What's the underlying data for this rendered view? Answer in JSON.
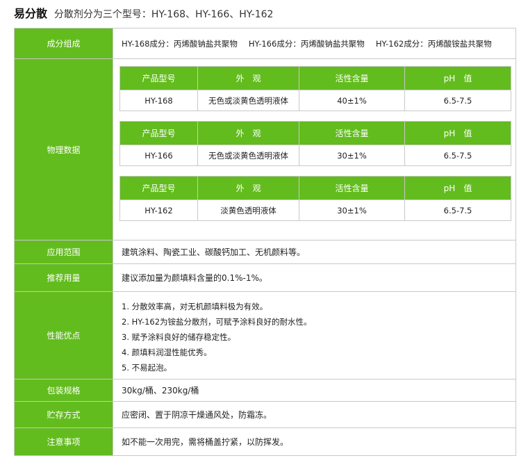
{
  "header": {
    "brand": "易分散",
    "subtitle": "分散剂分为三个型号：HY-168、HY-166、HY-162"
  },
  "rows": {
    "composition": {
      "label": "成分组成",
      "items": [
        "HY-168成分：丙烯酸钠盐共聚物",
        "HY-166成分：丙烯酸钠盐共聚物",
        "HY-162成分：丙烯酸铵盐共聚物"
      ]
    },
    "physical": {
      "label": "物理数据",
      "columns": [
        "产品型号",
        "外　观",
        "活性含量",
        "pH　值"
      ],
      "tables": [
        [
          "HY-168",
          "无色或淡黄色透明液体",
          "40±1%",
          "6.5-7.5"
        ],
        [
          "HY-166",
          "无色或淡黄色透明液体",
          "30±1%",
          "6.5-7.5"
        ],
        [
          "HY-162",
          "淡黄色透明液体",
          "30±1%",
          "6.5-7.5"
        ]
      ]
    },
    "application": {
      "label": "应用范围",
      "text": "建筑涂料、陶瓷工业、碳酸钙加工、无机颜料等。"
    },
    "dosage": {
      "label": "推荐用量",
      "text": "建议添加量为颜填料含量的0.1%-1%。"
    },
    "performance": {
      "label": "性能优点",
      "items": [
        "1. 分散效率高，对无机颜填料极为有效。",
        "2. HY-162为铵盐分散剂，可赋予涂料良好的耐水性。",
        "3. 赋予涂料良好的储存稳定性。",
        "4. 颜填料润湿性能优秀。",
        "5. 不易起泡。"
      ]
    },
    "packaging": {
      "label": "包装规格",
      "text": "30kg/桶、230kg/桶"
    },
    "storage": {
      "label": "贮存方式",
      "text": "应密闭、置于阴凉干燥通风处，防霜冻。"
    },
    "notes": {
      "label": "注意事项",
      "text": "如不能一次用完，需将桶盖拧紧，以防挥发。"
    }
  },
  "colors": {
    "accent": "#63bc1e",
    "border": "#c8c8c8"
  }
}
